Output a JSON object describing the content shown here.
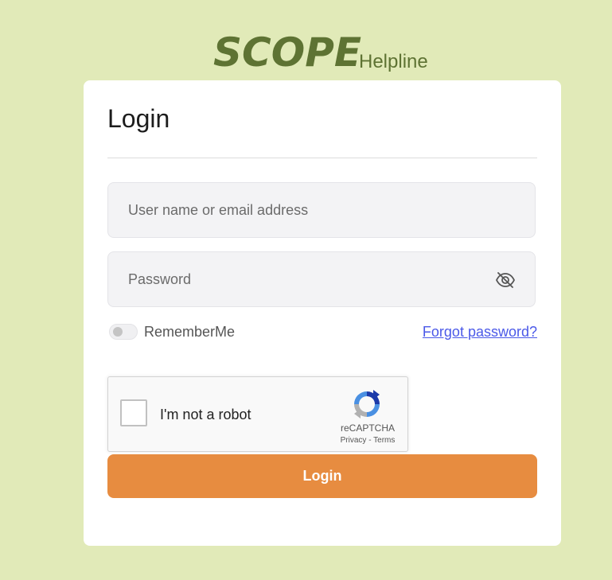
{
  "brand": {
    "name": "SCOPE",
    "subtitle": "Helpline"
  },
  "login_card": {
    "title": "Login",
    "username": {
      "value": "",
      "placeholder": "User name or email address"
    },
    "password": {
      "value": "",
      "placeholder": "Password",
      "visibility_icon": "eye-slash-icon"
    },
    "remember_me": {
      "label": "RememberMe",
      "checked": false
    },
    "forgot_password_label": "Forgot password?",
    "recaptcha": {
      "label": "I'm not a robot",
      "brand": "reCAPTCHA",
      "privacy": "Privacy",
      "separator": " - ",
      "terms": "Terms",
      "checked": false
    },
    "submit_label": "Login"
  },
  "colors": {
    "background": "#e1eab8",
    "brand": "#5e7333",
    "accent": "#e78c40",
    "link": "#4b59e8"
  }
}
